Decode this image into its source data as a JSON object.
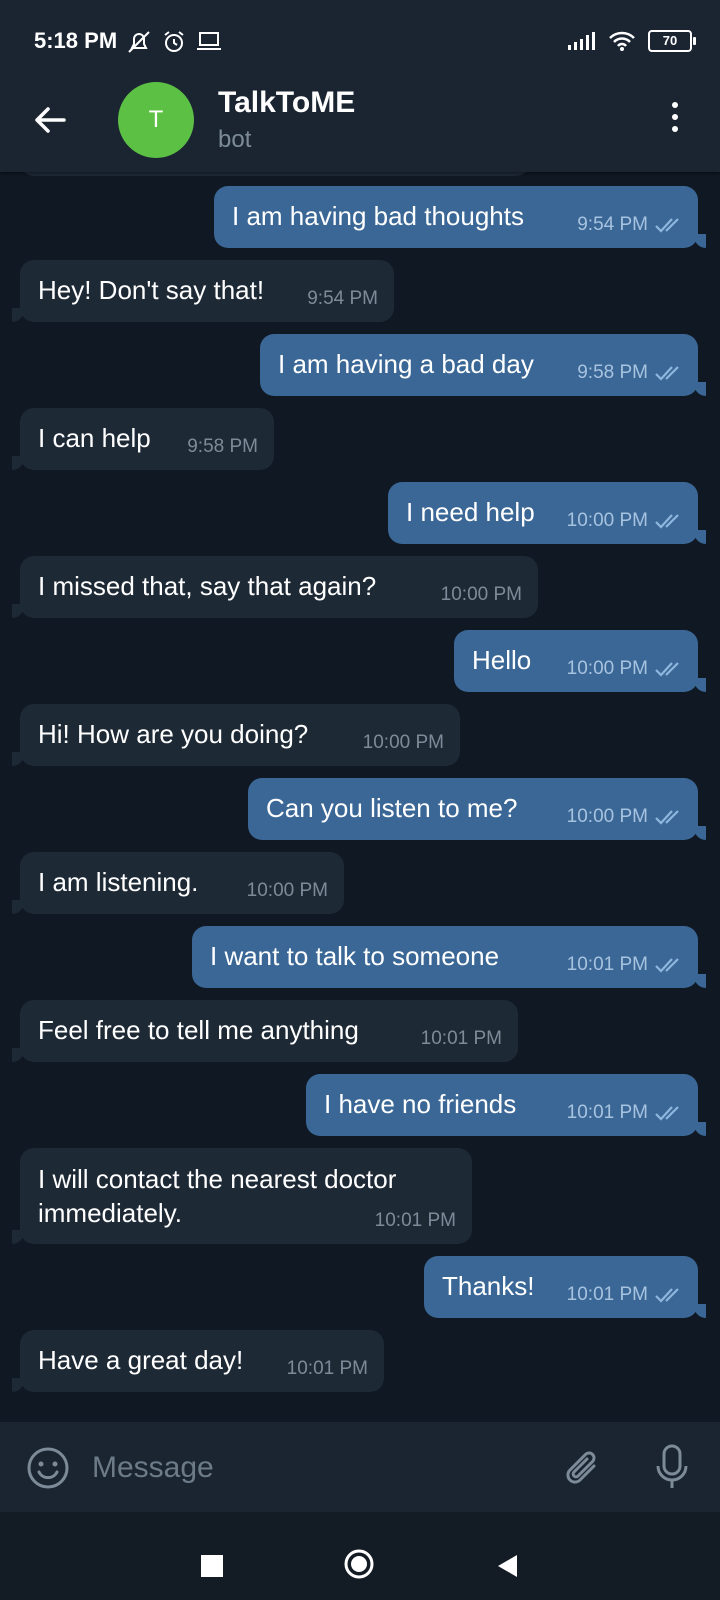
{
  "status_bar": {
    "time": "5:18 PM",
    "battery": "70"
  },
  "header": {
    "avatar_letter": "T",
    "title": "TalkToME",
    "subtitle": "bot"
  },
  "messages": [
    {
      "dir": "out",
      "text": "I am having bad thoughts",
      "time": "9:54 PM"
    },
    {
      "dir": "in",
      "text": "Hey! Don't say that!",
      "time": "9:54 PM"
    },
    {
      "dir": "out",
      "text": "I am having a bad day",
      "time": "9:58 PM"
    },
    {
      "dir": "in",
      "text": "I can help",
      "time": "9:58 PM"
    },
    {
      "dir": "out",
      "text": "I need help",
      "time": "10:00 PM"
    },
    {
      "dir": "in",
      "text": "I missed that, say that again?",
      "time": "10:00 PM"
    },
    {
      "dir": "out",
      "text": "Hello",
      "time": "10:00 PM"
    },
    {
      "dir": "in",
      "text": "Hi! How are you doing?",
      "time": "10:00 PM"
    },
    {
      "dir": "out",
      "text": "Can you listen to me?",
      "time": "10:00 PM"
    },
    {
      "dir": "in",
      "text": "I am listening.",
      "time": "10:00 PM"
    },
    {
      "dir": "out",
      "text": "I want to talk to someone",
      "time": "10:01 PM"
    },
    {
      "dir": "in",
      "text": "Feel free to tell me anything",
      "time": "10:01 PM"
    },
    {
      "dir": "out",
      "text": "I have no friends",
      "time": "10:01 PM"
    },
    {
      "dir": "in",
      "text": "I will contact the nearest doctor immediately.",
      "time": "10:01 PM"
    },
    {
      "dir": "out",
      "text": "Thanks!",
      "time": "10:01 PM"
    },
    {
      "dir": "in",
      "text": "Have a great day!",
      "time": "10:01 PM"
    }
  ],
  "input": {
    "placeholder": "Message"
  },
  "colors": {
    "outgoing": "#3a6795",
    "incoming": "#1e2936",
    "background": "#101823",
    "avatar": "#5cc045"
  },
  "icons": [
    "back-arrow-icon",
    "more-vertical-icon",
    "emoji-icon",
    "paperclip-icon",
    "microphone-icon",
    "double-check-icon"
  ]
}
